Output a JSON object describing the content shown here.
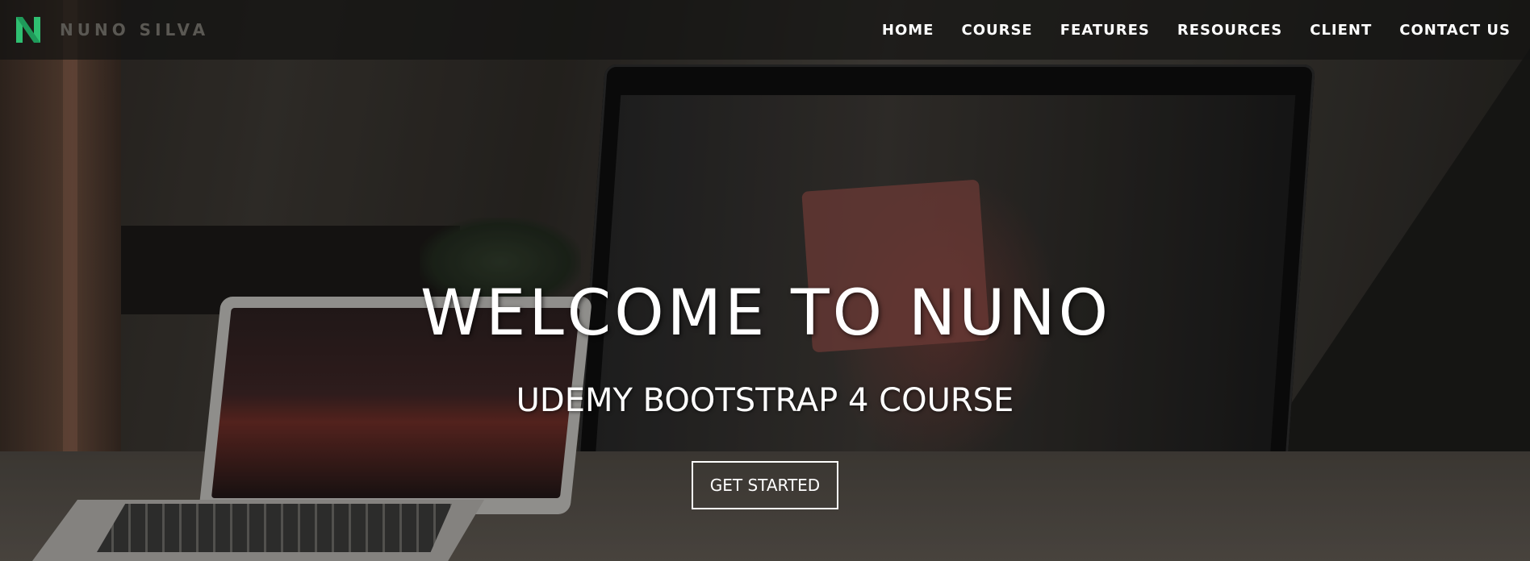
{
  "brand": {
    "name": "NUNO SILVA",
    "logo_icon": "n-logo-icon",
    "accent_color": "#2fbf71"
  },
  "nav": {
    "items": [
      {
        "label": "HOME"
      },
      {
        "label": "COURSE"
      },
      {
        "label": "FEATURES"
      },
      {
        "label": "RESOURCES"
      },
      {
        "label": "CLIENT"
      },
      {
        "label": "CONTACT US"
      }
    ]
  },
  "hero": {
    "title": "WELCOME TO NUNO",
    "subtitle": "UDEMY BOOTSTRAP 4 COURSE",
    "cta_label": "GET STARTED"
  }
}
